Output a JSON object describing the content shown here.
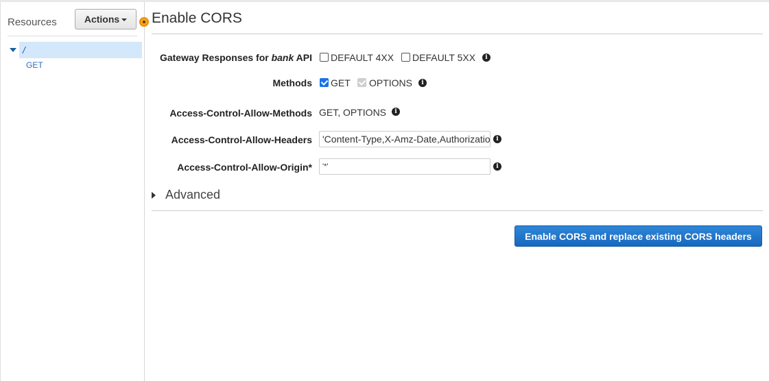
{
  "sidebar": {
    "title": "Resources",
    "actions_label": "Actions",
    "tree": {
      "root_label": "/",
      "children": [
        "GET"
      ]
    }
  },
  "main": {
    "title": "Enable CORS",
    "gateway": {
      "label_prefix": "Gateway Responses for ",
      "api_name": "bank",
      "label_suffix": " API",
      "options": [
        {
          "label": "DEFAULT 4XX",
          "checked": false
        },
        {
          "label": "DEFAULT 5XX",
          "checked": false
        }
      ]
    },
    "methods": {
      "label": "Methods",
      "options": [
        {
          "label": "GET",
          "checked": true
        },
        {
          "label": "OPTIONS",
          "checked": true,
          "disabled": true
        }
      ]
    },
    "allow_methods": {
      "label": "Access-Control-Allow-Methods",
      "value": "GET, OPTIONS"
    },
    "allow_headers": {
      "label": "Access-Control-Allow-Headers",
      "value": "'Content-Type,X-Amz-Date,Authorization,X-Api-Key,X-Amz-Security-Token'"
    },
    "allow_origin": {
      "label": "Access-Control-Allow-Origin*",
      "value": "'*'"
    },
    "advanced_label": "Advanced",
    "submit_label": "Enable CORS and replace existing CORS headers"
  },
  "icons": {
    "info": "info-icon",
    "expand": "caret-right-icon",
    "tree_toggle": "caret-down-icon"
  },
  "colors": {
    "primary": "#1a6fc4",
    "selected_row": "#d4e8fb",
    "marker": "#f6a623"
  }
}
